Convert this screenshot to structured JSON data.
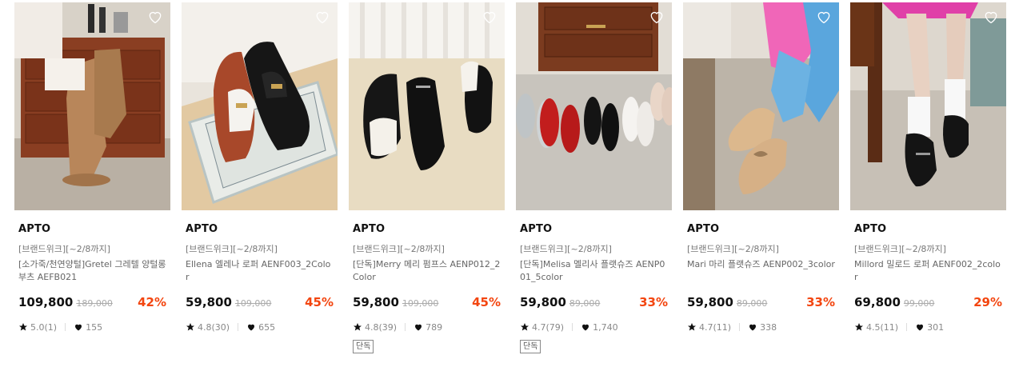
{
  "products": [
    {
      "brand": "APTO",
      "promo": "[브랜드위크][~2/8까지]",
      "name": "[소가죽/천연양털]Gretel 그레텔 양털롱부츠 AEFB021",
      "price": "109,800",
      "original_price": "189,000",
      "discount": "42%",
      "rating": "5.0(1)",
      "likes": "155",
      "badge": "",
      "image": "tall brown suede boots on wooden dresser"
    },
    {
      "brand": "APTO",
      "promo": "[브랜드위크][~2/8까지]",
      "name": "Ellena 엘레나 로퍼 AENF003_2Color",
      "price": "59,800",
      "original_price": "109,000",
      "discount": "45%",
      "rating": "4.8(30)",
      "likes": "655",
      "badge": "",
      "image": "brown and black loafers on rug"
    },
    {
      "brand": "APTO",
      "promo": "[브랜드위크][~2/8까지]",
      "name": "[단독]Merry 메리 펌프스 AENP012_2Color",
      "price": "59,800",
      "original_price": "109,000",
      "discount": "45%",
      "rating": "4.8(39)",
      "likes": "789",
      "badge": "단독",
      "image": "black mary jane pumps"
    },
    {
      "brand": "APTO",
      "promo": "[브랜드위크][~2/8까지]",
      "name": "[단독]Melisa 멜리사 플랫슈즈 AENP001_5color",
      "price": "59,800",
      "original_price": "89,000",
      "discount": "33%",
      "rating": "4.7(79)",
      "likes": "1,740",
      "badge": "단독",
      "image": "five color ballet flats in a row"
    },
    {
      "brand": "APTO",
      "promo": "[브랜드위크][~2/8까지]",
      "name": "Mari 마리 플랫슈즈 AENP002_3color",
      "price": "59,800",
      "original_price": "89,000",
      "discount": "33%",
      "rating": "4.7(11)",
      "likes": "338",
      "badge": "",
      "image": "beige bow flats worn by model"
    },
    {
      "brand": "APTO",
      "promo": "[브랜드위크][~2/8까지]",
      "name": "Millord 밀로드 로퍼 AENF002_2color",
      "price": "69,800",
      "original_price": "99,000",
      "discount": "29%",
      "rating": "4.5(11)",
      "likes": "301",
      "badge": "",
      "image": "black strap loafers with white socks"
    }
  ],
  "colors": {
    "discount": "#f3450f",
    "text": "#111111",
    "muted": "#888888"
  },
  "icons": {
    "wishlist": "heart-outline-icon",
    "rating": "star-icon",
    "likes": "heart-icon"
  }
}
